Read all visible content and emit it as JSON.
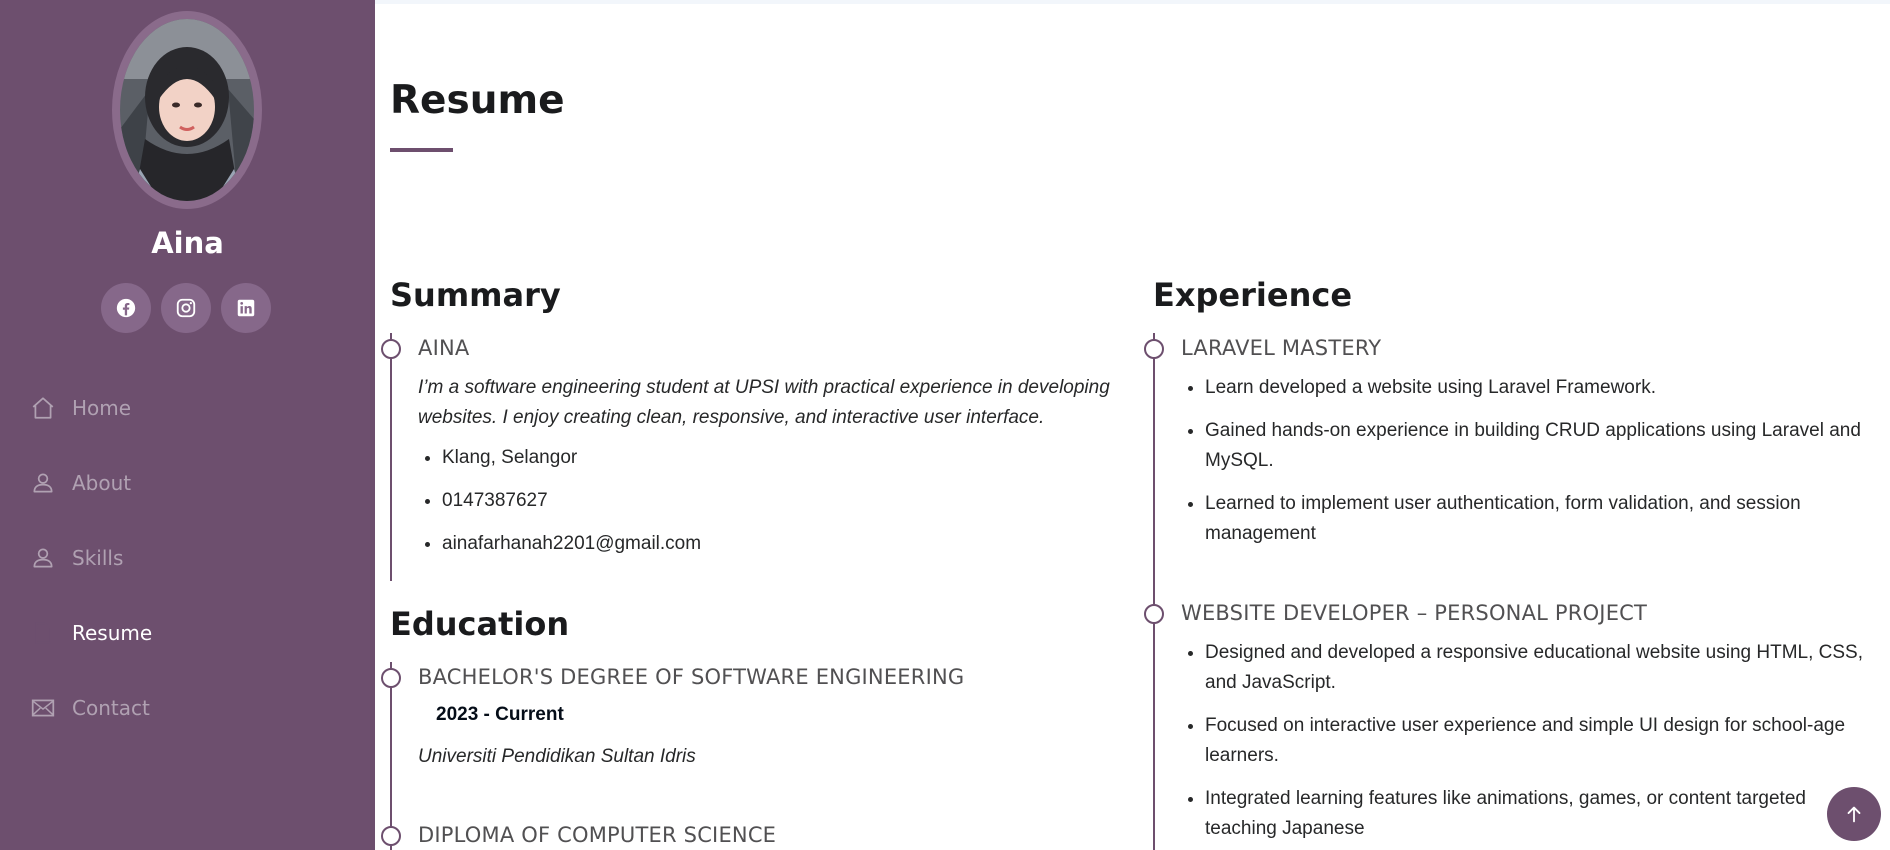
{
  "sidebar": {
    "profile_name": "Aina",
    "social": [
      {
        "icon": "facebook-icon"
      },
      {
        "icon": "instagram-icon"
      },
      {
        "icon": "linkedin-icon"
      }
    ],
    "nav": [
      {
        "label": "Home",
        "icon": "home-icon",
        "active": false
      },
      {
        "label": "About",
        "icon": "person-icon",
        "active": false
      },
      {
        "label": "Skills",
        "icon": "person-icon",
        "active": false
      },
      {
        "label": "Resume",
        "icon": "file-icon",
        "active": true
      },
      {
        "label": "Contact",
        "icon": "envelope-icon",
        "active": false
      }
    ]
  },
  "main": {
    "page_title": "Resume",
    "summary": {
      "heading": "Summary",
      "item_title": "AINA",
      "text": "I’m a software engineering student at UPSI with practical experience in developing websites. I enjoy creating clean, responsive, and interactive user interface.",
      "details": [
        "Klang, Selangor",
        "0147387627",
        "ainafarhanah2201@gmail.com"
      ]
    },
    "education": {
      "heading": "Education",
      "items": [
        {
          "title": "BACHELOR'S DEGREE OF SOFTWARE ENGINEERING",
          "years": "2023 - Current",
          "school": "Universiti Pendidikan Sultan Idris"
        },
        {
          "title": "DIPLOMA OF COMPUTER SCIENCE"
        }
      ]
    },
    "experience": {
      "heading": "Experience",
      "items": [
        {
          "title": "LARAVEL MASTERY",
          "bullets": [
            "Learn developed a website using Laravel Framework.",
            "Gained hands-on experience in building CRUD applications using Laravel and MySQL.",
            "Learned to implement user authentication, form validation, and session management"
          ]
        },
        {
          "title": "WEBSITE DEVELOPER – PERSONAL PROJECT",
          "bullets": [
            "Designed and developed a responsive educational website using HTML, CSS, and JavaScript.",
            "Focused on interactive user experience and simple UI design for school-age learners.",
            "Integrated learning features like animations, games, or content targeted teaching Japanese"
          ]
        }
      ]
    }
  },
  "colors": {
    "sidebar_bg": "#6d4f6e",
    "accent": "#6d4f6e",
    "nav_inactive": "#b0a1b2",
    "nav_active": "#ffffff"
  },
  "back_to_top_icon": "arrow-up-icon"
}
